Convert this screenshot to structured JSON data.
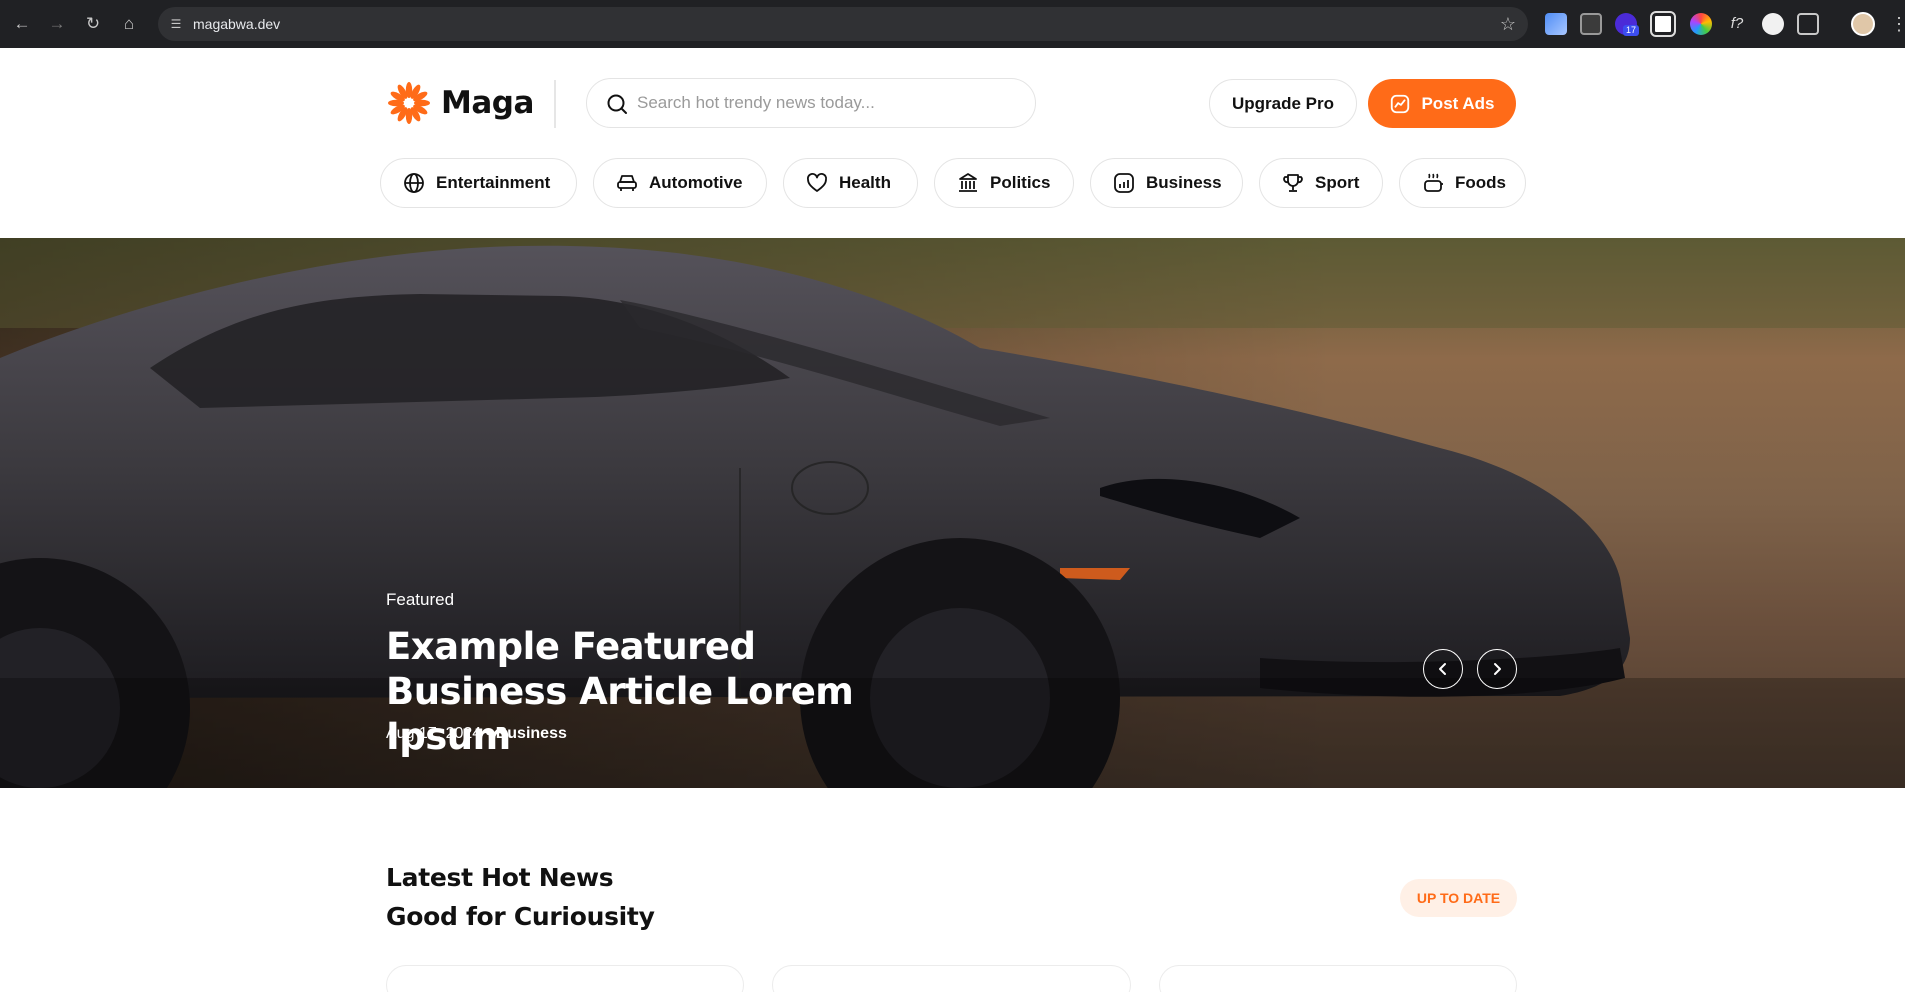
{
  "browser": {
    "url": "magabwa.dev",
    "extension_badge": "17"
  },
  "site": {
    "logo_text": "Maga",
    "search_placeholder": "Search hot trendy news today...",
    "upgrade_label": "Upgrade Pro",
    "post_ads_label": "Post Ads",
    "accent_color": "#ff6b18"
  },
  "categories": [
    {
      "label": "Entertainment",
      "icon": "globe-icon"
    },
    {
      "label": "Automotive",
      "icon": "car-icon"
    },
    {
      "label": "Health",
      "icon": "heart-icon"
    },
    {
      "label": "Politics",
      "icon": "building-icon"
    },
    {
      "label": "Business",
      "icon": "chart-icon"
    },
    {
      "label": "Sport",
      "icon": "trophy-icon"
    },
    {
      "label": "Foods",
      "icon": "cooking-pot-icon"
    }
  ],
  "hero": {
    "tag": "Featured",
    "title": "Example Featured Business Article Lorem Ipsum",
    "date": "Aug 17, 2024",
    "separator": "•",
    "category": "Business"
  },
  "latest": {
    "title_line1": "Latest Hot News",
    "title_line2": "Good for Curiousity",
    "badge": "UP TO DATE"
  }
}
